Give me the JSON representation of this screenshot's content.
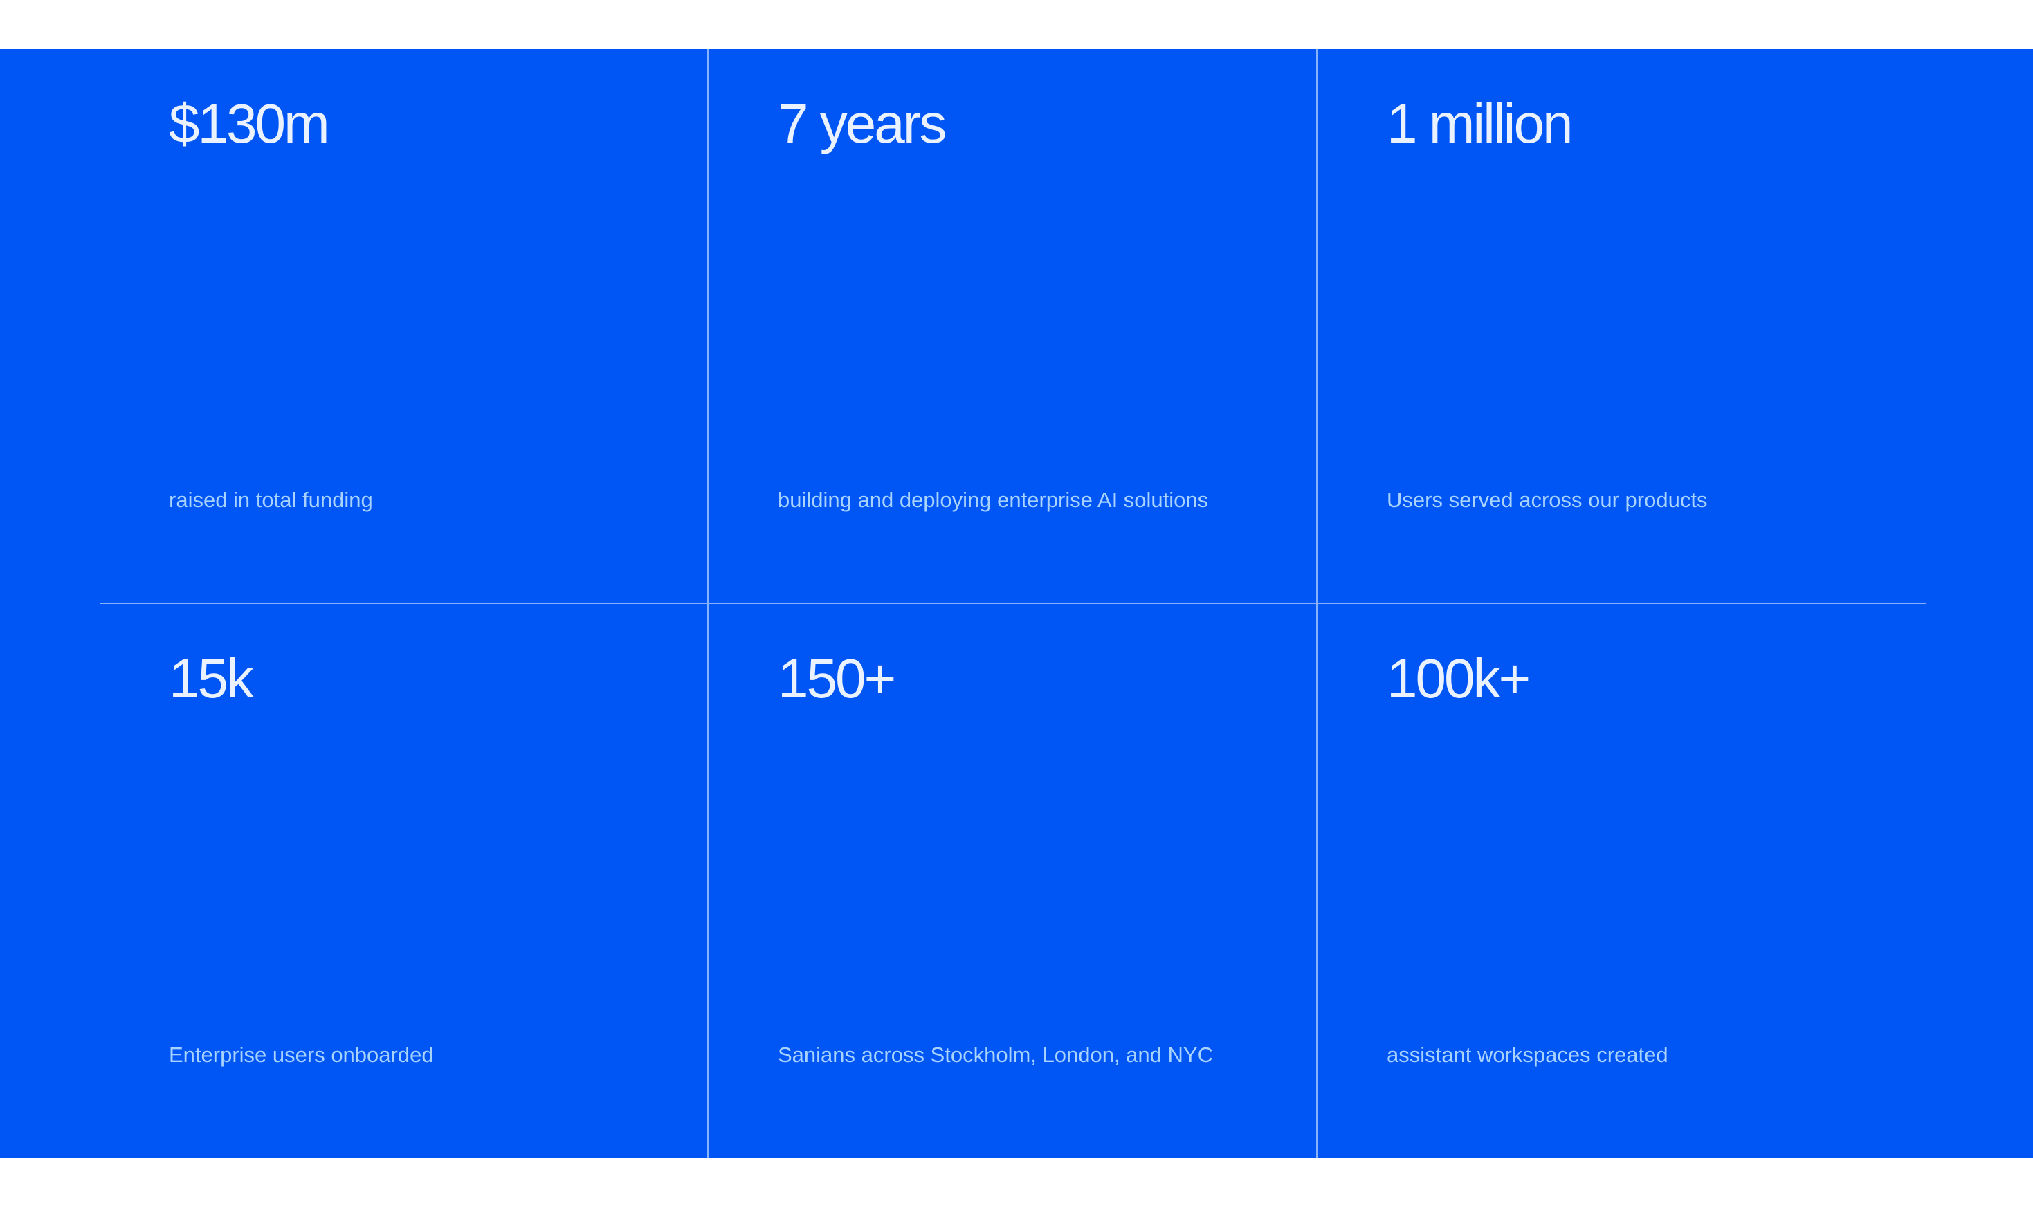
{
  "colors": {
    "section_background": "#0056F5",
    "value_text": "#EAF2FF",
    "label_text": "#A9D3FF",
    "divider": "#B4D2FF"
  },
  "stats": [
    {
      "value": "$130m",
      "label": "raised in total funding"
    },
    {
      "value": "7 years",
      "label": "building and deploying enterprise AI solutions"
    },
    {
      "value": "1 million",
      "label": "Users served across our products"
    },
    {
      "value": "15k",
      "label": "Enterprise users onboarded"
    },
    {
      "value": "150+",
      "label": "Sanians across Stockholm, London, and NYC"
    },
    {
      "value": "100k+",
      "label": "assistant workspaces created"
    }
  ]
}
